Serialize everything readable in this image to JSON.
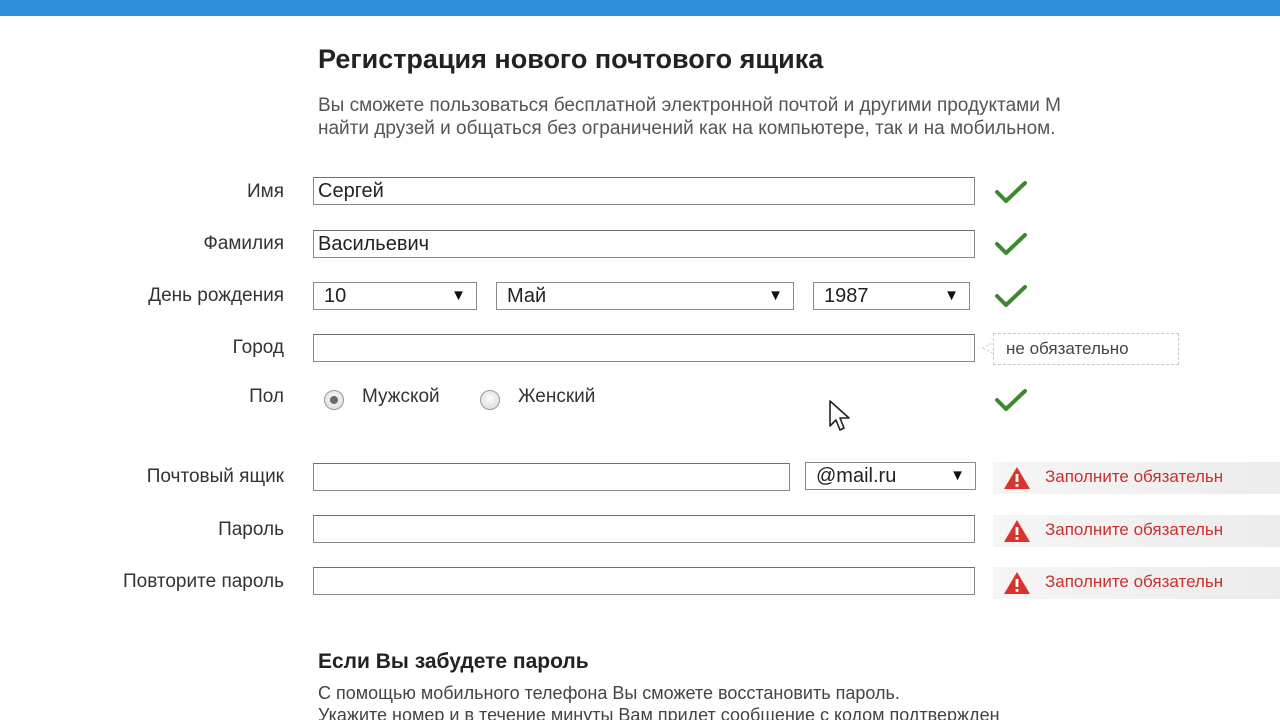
{
  "header": {
    "title": "Регистрация нового почтового ящика",
    "intro_line1": "Вы сможете пользоваться бесплатной электронной почтой и другими продуктами М",
    "intro_line2": "найти друзей и общаться без ограничений как на компьютере, так и на мобильном."
  },
  "form": {
    "first_name": {
      "label": "Имя",
      "value": "Сергей"
    },
    "last_name": {
      "label": "Фамилия",
      "value": "Васильевич"
    },
    "birthday": {
      "label": "День рождения",
      "day": "10",
      "month": "Май",
      "year": "1987"
    },
    "city": {
      "label": "Город",
      "value": "",
      "hint": "не обязательно"
    },
    "gender": {
      "label": "Пол",
      "male": "Мужской",
      "female": "Женский",
      "selected": "male"
    },
    "mailbox": {
      "label": "Почтовый ящик",
      "value": "",
      "domain": "@mail.ru",
      "error": "Заполните обязательн"
    },
    "password": {
      "label": "Пароль",
      "value": "",
      "error": "Заполните обязательн"
    },
    "password_repeat": {
      "label": "Повторите пароль",
      "value": "",
      "error": "Заполните обязательн"
    }
  },
  "recovery": {
    "title": "Если Вы забудете пароль",
    "text_line1": "С помощью мобильного телефона Вы сможете восстановить пароль.",
    "text_line2": "Укажите номер и в течение минуты Вам придет сообщение с кодом подтвержден"
  },
  "colors": {
    "accent_bar": "#2f8fd8",
    "check": "#3d8a2e",
    "error_text": "#c9302c",
    "warn_icon": "#d9342b"
  },
  "icons": {
    "valid": "checkmark-icon",
    "error": "warning-icon",
    "dropdown": "triangle-down-icon",
    "pointer": "mouse-cursor-icon"
  }
}
